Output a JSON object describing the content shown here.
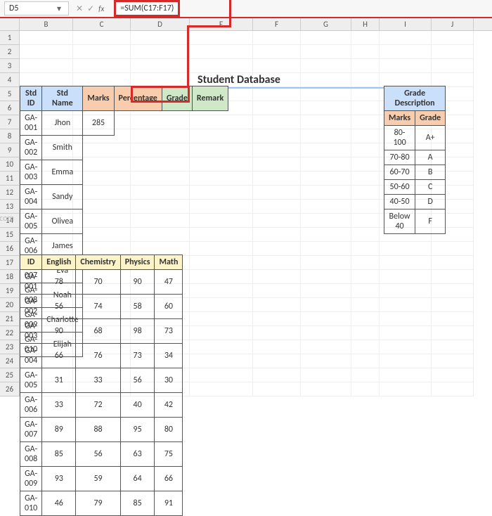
{
  "namebox": {
    "value": "D5",
    "dropdown_icon": "▾"
  },
  "fx": {
    "cancel": "✕",
    "confirm": "✓",
    "label": "fx"
  },
  "formula": "=SUM(C17:F17)",
  "columns": [
    "B",
    "C",
    "D",
    "E",
    "F",
    "G",
    "H",
    "I",
    "J"
  ],
  "row_numbers": [
    1,
    2,
    3,
    4,
    5,
    6,
    7,
    8,
    9,
    10,
    11,
    12,
    13,
    14,
    15,
    16,
    17,
    18,
    19,
    20,
    21,
    22,
    23,
    24,
    25,
    26
  ],
  "title": "Student Database",
  "student_headers": [
    "Std ID",
    "Std Name",
    "Marks",
    "Percentage",
    "Grade",
    "Remark"
  ],
  "students": [
    {
      "id": "GA-001",
      "name": "Jhon",
      "marks": "285"
    },
    {
      "id": "GA-002",
      "name": "Smith",
      "marks": ""
    },
    {
      "id": "GA-003",
      "name": "Emma",
      "marks": ""
    },
    {
      "id": "GA-004",
      "name": "Sandy",
      "marks": ""
    },
    {
      "id": "GA-005",
      "name": "Olivea",
      "marks": ""
    },
    {
      "id": "GA-006",
      "name": "James",
      "marks": ""
    },
    {
      "id": "GA-007",
      "name": "Eva",
      "marks": ""
    },
    {
      "id": "GA-008",
      "name": "Noah",
      "marks": ""
    },
    {
      "id": "GA-009",
      "name": "Charlotte",
      "marks": ""
    },
    {
      "id": "GA-010",
      "name": "Elijah",
      "marks": ""
    }
  ],
  "marks_headers": [
    "ID",
    "English",
    "Chemistry",
    "Physics",
    "Math"
  ],
  "marks": [
    {
      "id": "GA-001",
      "eng": 78,
      "chem": 70,
      "phy": 90,
      "math": 47
    },
    {
      "id": "GA-002",
      "eng": 56,
      "chem": 74,
      "phy": 58,
      "math": 60
    },
    {
      "id": "GA-003",
      "eng": 90,
      "chem": 68,
      "phy": 98,
      "math": 73
    },
    {
      "id": "GA-004",
      "eng": 66,
      "chem": 76,
      "phy": 73,
      "math": 34
    },
    {
      "id": "GA-005",
      "eng": 31,
      "chem": 33,
      "phy": 56,
      "math": 30
    },
    {
      "id": "GA-006",
      "eng": 33,
      "chem": 72,
      "phy": 40,
      "math": 42
    },
    {
      "id": "GA-007",
      "eng": 89,
      "chem": 88,
      "phy": 95,
      "math": 80
    },
    {
      "id": "GA-008",
      "eng": 85,
      "chem": 56,
      "phy": 63,
      "math": 75
    },
    {
      "id": "GA-009",
      "eng": 93,
      "chem": 59,
      "phy": 64,
      "math": 66
    },
    {
      "id": "GA-010",
      "eng": 46,
      "chem": 79,
      "phy": 85,
      "math": 91
    }
  ],
  "grade_title": "Grade Description",
  "grade_headers": [
    "Marks",
    "Grade"
  ],
  "grades": [
    {
      "range": "80-100",
      "grade": "A+"
    },
    {
      "range": "70-80",
      "grade": "A"
    },
    {
      "range": "60-70",
      "grade": "B"
    },
    {
      "range": "50-60",
      "grade": "C"
    },
    {
      "range": "40-50",
      "grade": "D"
    },
    {
      "range": "Below 40",
      "grade": "F"
    }
  ],
  "watermark": "wsxdn.com"
}
